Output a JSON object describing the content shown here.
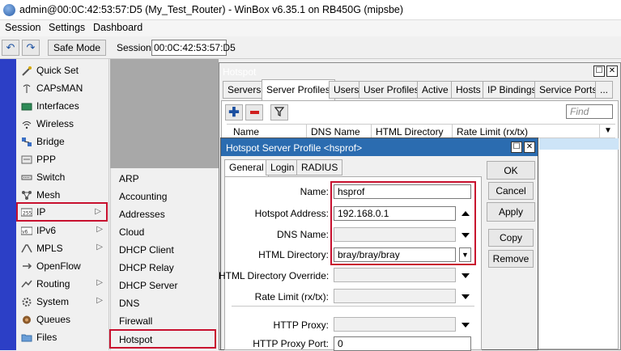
{
  "window": {
    "title": "admin@00:0C:42:53:57:D5 (My_Test_Router) - WinBox v6.35.1 on RB450G (mipsbe)"
  },
  "menu": [
    "Session",
    "Settings",
    "Dashboard"
  ],
  "toolbar": {
    "undo_icon": "undo-icon",
    "redo_icon": "redo-icon",
    "safe_mode": "Safe Mode",
    "session_label": "Session:",
    "session_value": "00:0C:42:53:57:D5"
  },
  "sidebar": {
    "items": [
      {
        "label": "Quick Set",
        "icon": "wand-icon"
      },
      {
        "label": "CAPsMAN",
        "icon": "antenna-icon"
      },
      {
        "label": "Interfaces",
        "icon": "interfaces-icon"
      },
      {
        "label": "Wireless",
        "icon": "wireless-icon"
      },
      {
        "label": "Bridge",
        "icon": "bridge-icon"
      },
      {
        "label": "PPP",
        "icon": "ppp-icon"
      },
      {
        "label": "Switch",
        "icon": "switch-icon"
      },
      {
        "label": "Mesh",
        "icon": "mesh-icon"
      },
      {
        "label": "IP",
        "icon": "ip-icon",
        "submenu": true,
        "highlighted": true
      },
      {
        "label": "IPv6",
        "icon": "ipv6-icon",
        "submenu": true
      },
      {
        "label": "MPLS",
        "icon": "mpls-icon",
        "submenu": true
      },
      {
        "label": "OpenFlow",
        "icon": "openflow-icon"
      },
      {
        "label": "Routing",
        "icon": "routing-icon",
        "submenu": true
      },
      {
        "label": "System",
        "icon": "system-icon",
        "submenu": true
      },
      {
        "label": "Queues",
        "icon": "queues-icon"
      },
      {
        "label": "Files",
        "icon": "files-icon"
      }
    ]
  },
  "ip_submenu": [
    "ARP",
    "Accounting",
    "Addresses",
    "Cloud",
    "DHCP Client",
    "DHCP Relay",
    "DHCP Server",
    "DNS",
    "Firewall",
    "Hotspot"
  ],
  "hotspot": {
    "title": "Hotspot",
    "tabs": [
      "Servers",
      "Server Profiles",
      "Users",
      "User Profiles",
      "Active",
      "Hosts",
      "IP Bindings",
      "Service Ports",
      "..."
    ],
    "active_tab": "Server Profiles",
    "find_placeholder": "Find",
    "columns": [
      "Name",
      "DNS Name",
      "HTML Directory",
      "Rate Limit (rx/tx)"
    ]
  },
  "profile_dialog": {
    "title": "Hotspot Server Profile <hsprof>",
    "tabs": [
      "General",
      "Login",
      "RADIUS"
    ],
    "fields": {
      "name_label": "Name:",
      "name_value": "hsprof",
      "hotspot_address_label": "Hotspot Address:",
      "hotspot_address_value": "192.168.0.1",
      "dns_name_label": "DNS Name:",
      "dns_name_value": "",
      "html_directory_label": "HTML Directory:",
      "html_directory_value": "bray/bray/bray",
      "html_directory_override_label": "HTML Directory Override:",
      "html_directory_override_value": "",
      "rate_limit_label": "Rate Limit (rx/tx):",
      "rate_limit_value": "",
      "http_proxy_label": "HTTP Proxy:",
      "http_proxy_value": "",
      "http_proxy_port_label": "HTTP Proxy Port:",
      "http_proxy_port_value": "0"
    },
    "buttons": {
      "ok": "OK",
      "cancel": "Cancel",
      "apply": "Apply",
      "copy": "Copy",
      "remove": "Remove"
    }
  },
  "colors": {
    "sidebar_bar": "#2c3fc6",
    "dialog_titlebar": "#2b6cb0",
    "highlight": "#c8102e"
  }
}
